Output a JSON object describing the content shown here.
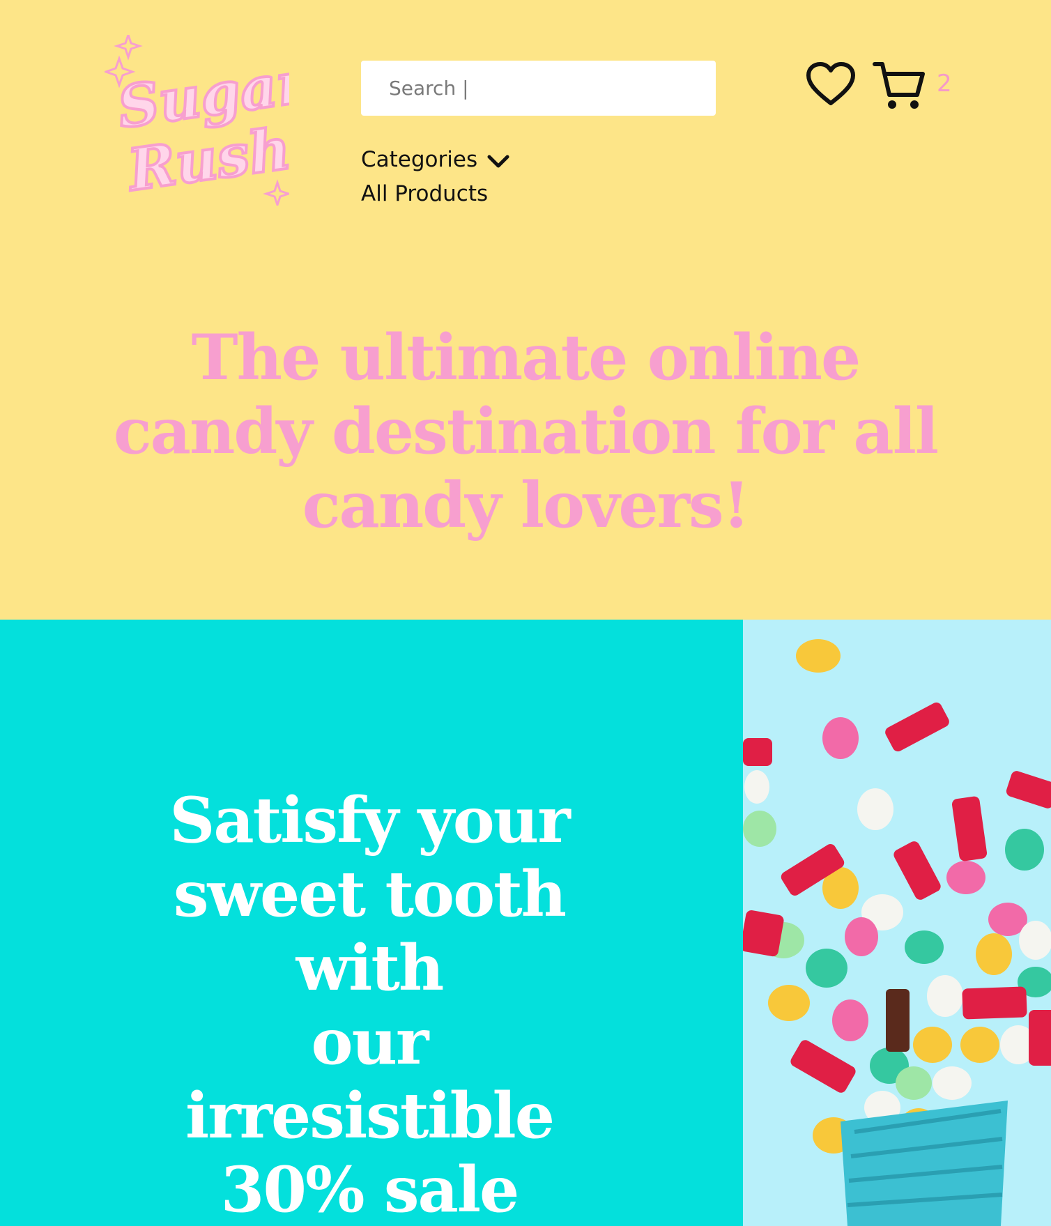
{
  "brand": {
    "logo_text_line1": "Sugar",
    "logo_text_line2": "Rush"
  },
  "search": {
    "placeholder": "Search |"
  },
  "nav": {
    "categories_label": "Categories",
    "all_products_label": "All Products"
  },
  "cart": {
    "count": "2"
  },
  "hero": {
    "headline": "The ultimate online candy destination for all candy lovers!"
  },
  "promo": {
    "lines": [
      "Satisfy your",
      "sweet tooth",
      "with",
      "our",
      "irresistible",
      "30% sale"
    ]
  },
  "colors": {
    "background": "#fde588",
    "pink": "#f79fcf",
    "teal": "#04e0dc",
    "photo_bg": "#b8f0fa",
    "white": "#ffffff"
  },
  "icons": {
    "wishlist": "heart-icon",
    "cart": "cart-icon",
    "dropdown": "chevron-down-icon"
  }
}
